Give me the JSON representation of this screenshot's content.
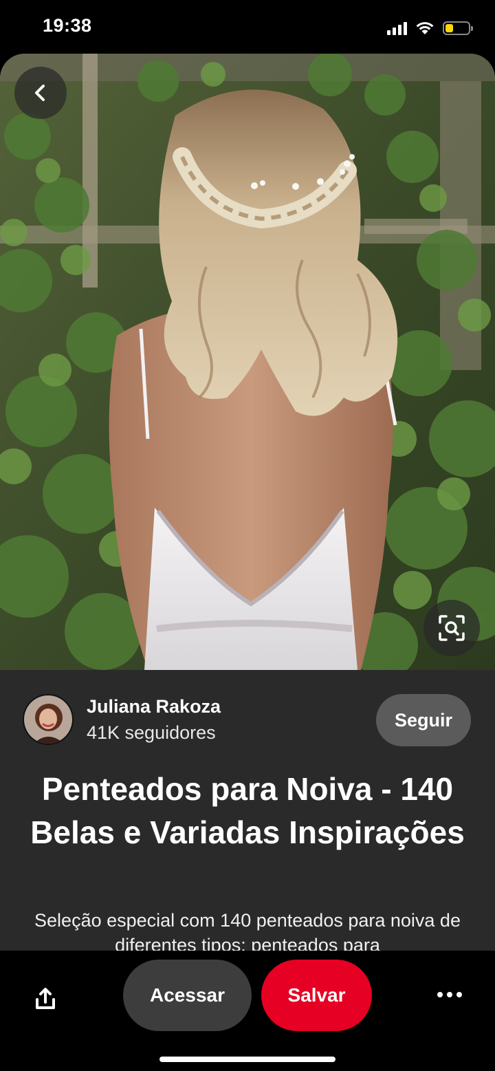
{
  "status_bar": {
    "time": "19:38",
    "icons": [
      "signal-icon",
      "wifi-icon",
      "battery-icon"
    ],
    "battery_level": 0.35,
    "battery_color": "#ffd60a"
  },
  "pin": {
    "image_alt": "Noiva de costas com trança e cabelo ondulado",
    "back_icon": "chevron-left-icon",
    "lens_icon": "visual-search-icon"
  },
  "author": {
    "name": "Juliana Rakoza",
    "followers": "41K seguidores",
    "follow_label": "Seguir"
  },
  "content": {
    "title": "Penteados para Noiva - 140 Belas e Variadas Inspirações",
    "description": "Seleção especial com 140 penteados para noiva de diferentes tipos: penteados para"
  },
  "actions": {
    "share_icon": "share-icon",
    "visit_label": "Acessar",
    "save_label": "Salvar",
    "save_color": "#e60023",
    "more_icon": "more-icon"
  }
}
